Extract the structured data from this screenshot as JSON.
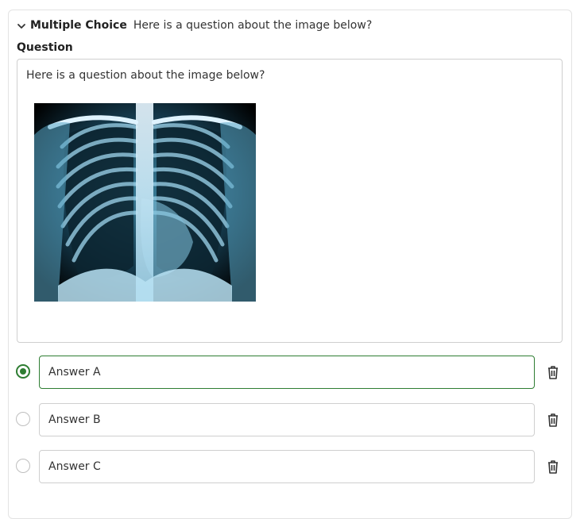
{
  "header": {
    "type_label": "Multiple Choice",
    "summary": "Here is a question about the image below?"
  },
  "question": {
    "label": "Question",
    "text": "Here is a question about the image below?",
    "image_icon": "chest-xray-image"
  },
  "answers": [
    {
      "value": "Answer A",
      "selected": true
    },
    {
      "value": "Answer B",
      "selected": false
    },
    {
      "value": "Answer C",
      "selected": false
    }
  ],
  "colors": {
    "accent": "#2e7d32",
    "border": "#cfcfcf",
    "text": "#222222"
  },
  "icons": {
    "collapse": "chevron-down-icon",
    "delete": "trash-icon"
  }
}
